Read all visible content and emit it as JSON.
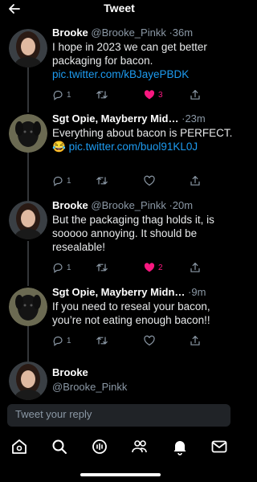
{
  "header": {
    "title": "Tweet"
  },
  "tweets": [
    {
      "name": "Brooke",
      "handle": "@Brooke_Pinkk",
      "time": "36m",
      "text": "I hope in 2023 we can get better packaging for bacon.",
      "link": "pic.twitter.com/kBJayePBDK",
      "reply_count": "1",
      "retweet_count": "",
      "like_count": "3",
      "liked": true
    },
    {
      "name": "Sgt Opie, Mayberry Mid…",
      "handle": "",
      "time": "23m",
      "text": "Everything about bacon is PERFECT. 😂",
      "link": "pic.twitter.com/buol91KL0J",
      "reply_count": "1",
      "retweet_count": "",
      "like_count": "",
      "liked": false
    },
    {
      "name": "Brooke",
      "handle": "@Brooke_Pinkk",
      "time": "20m",
      "text": "But the packaging thag holds it, is sooooo annoying. It should be resealable!",
      "link": "",
      "reply_count": "1",
      "retweet_count": "",
      "like_count": "2",
      "liked": true
    },
    {
      "name": "Sgt Opie, Mayberry Midn…",
      "handle": "",
      "time": "9m",
      "text": "If you need to reseal your bacon, you’re not eating enough bacon!!",
      "link": "",
      "reply_count": "1",
      "retweet_count": "",
      "like_count": "",
      "liked": false
    }
  ],
  "current_user": {
    "name": "Brooke",
    "handle": "@Brooke_Pinkk"
  },
  "reply": {
    "placeholder": "Tweet your reply"
  },
  "tabs": [
    "home-icon",
    "search-icon",
    "spaces-icon",
    "communities-icon",
    "notifications-icon",
    "messages-icon"
  ],
  "colors": {
    "link": "#1d9bf0",
    "like": "#f91880",
    "muted": "#8b98a5",
    "background": "#000000"
  }
}
